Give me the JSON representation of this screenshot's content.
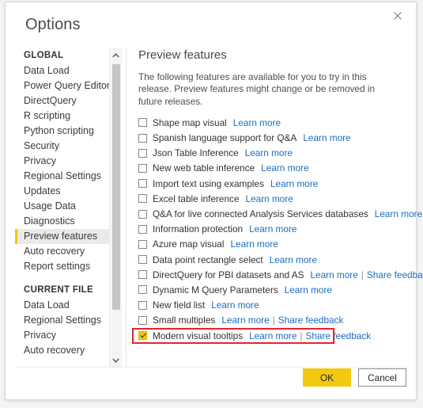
{
  "dialog": {
    "title": "Options",
    "close_icon": "close-icon"
  },
  "sidebar": {
    "groups": [
      {
        "header": "GLOBAL",
        "items": [
          {
            "label": "Data Load",
            "selected": false
          },
          {
            "label": "Power Query Editor",
            "selected": false
          },
          {
            "label": "DirectQuery",
            "selected": false
          },
          {
            "label": "R scripting",
            "selected": false
          },
          {
            "label": "Python scripting",
            "selected": false
          },
          {
            "label": "Security",
            "selected": false
          },
          {
            "label": "Privacy",
            "selected": false
          },
          {
            "label": "Regional Settings",
            "selected": false
          },
          {
            "label": "Updates",
            "selected": false
          },
          {
            "label": "Usage Data",
            "selected": false
          },
          {
            "label": "Diagnostics",
            "selected": false
          },
          {
            "label": "Preview features",
            "selected": true
          },
          {
            "label": "Auto recovery",
            "selected": false
          },
          {
            "label": "Report settings",
            "selected": false
          }
        ]
      },
      {
        "header": "CURRENT FILE",
        "items": [
          {
            "label": "Data Load",
            "selected": false
          },
          {
            "label": "Regional Settings",
            "selected": false
          },
          {
            "label": "Privacy",
            "selected": false
          },
          {
            "label": "Auto recovery",
            "selected": false
          }
        ]
      }
    ],
    "scrollbar": {
      "up_icon": "chevron-up-icon",
      "down_icon": "chevron-down-icon"
    }
  },
  "content": {
    "heading": "Preview features",
    "description": "The following features are available for you to try in this release. Preview features might change or be removed in future releases.",
    "link_separator": "|",
    "features": [
      {
        "label": "Shape map visual",
        "checked": false,
        "links": [
          "Learn more"
        ]
      },
      {
        "label": "Spanish language support for Q&A",
        "checked": false,
        "links": [
          "Learn more"
        ]
      },
      {
        "label": "Json Table Inference",
        "checked": false,
        "links": [
          "Learn more"
        ]
      },
      {
        "label": "New web table inference",
        "checked": false,
        "links": [
          "Learn more"
        ]
      },
      {
        "label": "Import text using examples",
        "checked": false,
        "links": [
          "Learn more"
        ]
      },
      {
        "label": "Excel table inference",
        "checked": false,
        "links": [
          "Learn more"
        ]
      },
      {
        "label": "Q&A for live connected Analysis Services databases",
        "checked": false,
        "links": [
          "Learn more"
        ]
      },
      {
        "label": "Information protection",
        "checked": false,
        "links": [
          "Learn more"
        ]
      },
      {
        "label": "Azure map visual",
        "checked": false,
        "links": [
          "Learn more"
        ]
      },
      {
        "label": "Data point rectangle select",
        "checked": false,
        "links": [
          "Learn more"
        ]
      },
      {
        "label": "DirectQuery for PBI datasets and AS",
        "checked": false,
        "links": [
          "Learn more",
          "Share feedback"
        ]
      },
      {
        "label": "Dynamic M Query Parameters",
        "checked": false,
        "links": [
          "Learn more"
        ]
      },
      {
        "label": "New field list",
        "checked": false,
        "links": [
          "Learn more"
        ]
      },
      {
        "label": "Small multiples",
        "checked": false,
        "links": [
          "Learn more",
          "Share feedback"
        ]
      },
      {
        "label": "Modern visual tooltips",
        "checked": true,
        "highlighted": true,
        "links": [
          "Learn more",
          "Share feedback"
        ]
      }
    ]
  },
  "footer": {
    "ok_label": "OK",
    "cancel_label": "Cancel"
  },
  "colors": {
    "accent": "#f2c811",
    "link": "#1a6dbf",
    "highlight": "#e8232a"
  }
}
